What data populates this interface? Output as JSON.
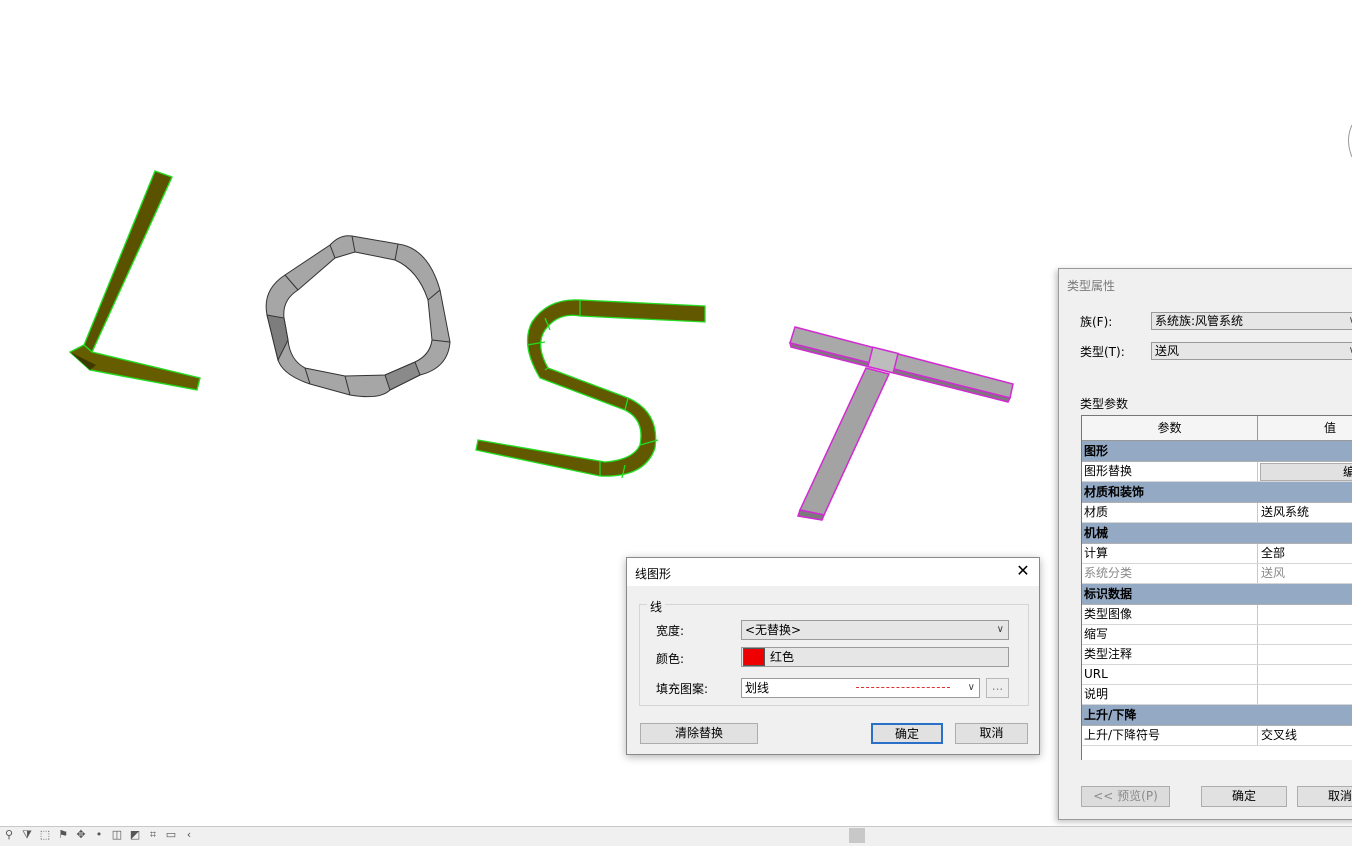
{
  "type_properties": {
    "title": "类型属性",
    "family_label": "族(F):",
    "family_value": "系统族:风管系统",
    "type_label": "类型(T):",
    "type_value": "送风",
    "section_label": "类型参数",
    "col_param": "参数",
    "col_value": "值",
    "groups": [
      {
        "name": "图形",
        "rows": [
          {
            "k": "图形替换",
            "v": "编辑",
            "button": true
          }
        ]
      },
      {
        "name": "材质和装饰",
        "rows": [
          {
            "k": "材质",
            "v": "送风系统"
          }
        ]
      },
      {
        "name": "机械",
        "rows": [
          {
            "k": "计算",
            "v": "全部"
          },
          {
            "k": "系统分类",
            "v": "送风",
            "dim": true
          }
        ]
      },
      {
        "name": "标识数据",
        "rows": [
          {
            "k": "类型图像",
            "v": ""
          },
          {
            "k": "缩写",
            "v": ""
          },
          {
            "k": "类型注释",
            "v": ""
          },
          {
            "k": "URL",
            "v": ""
          },
          {
            "k": "说明",
            "v": ""
          }
        ]
      },
      {
        "name": "上升/下降",
        "rows": [
          {
            "k": "上升/下降符号",
            "v": "交叉线"
          }
        ]
      }
    ],
    "preview_button": "<< 预览(P)",
    "ok_button": "确定",
    "cancel_button": "取消"
  },
  "line_graphics": {
    "title": "线图形",
    "group": "线",
    "width_label": "宽度:",
    "width_value": "<无替换>",
    "color_label": "颜色:",
    "color_value": "红色",
    "color_hex": "#ee0000",
    "pattern_label": "填充图案:",
    "pattern_value": "划线",
    "dots": "...",
    "clear_button": "清除替换",
    "ok_button": "确定",
    "cancel_button": "取消"
  },
  "status_icons": [
    "link-icon",
    "filter-icon",
    "selection-icon",
    "pin-icon",
    "drag-icon",
    "marker-icon",
    "camera-icon",
    "render-icon",
    "crop-icon",
    "view-icon",
    "collapse-icon"
  ]
}
